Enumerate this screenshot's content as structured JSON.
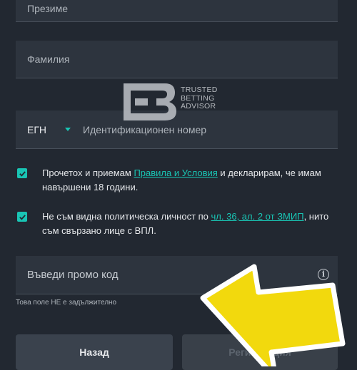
{
  "form": {
    "middle_name_placeholder": "Презиме",
    "last_name_placeholder": "Фамилия",
    "id_type_selected": "ЕГН",
    "id_number_placeholder": "Идентификационен номер",
    "promo_placeholder": "Въведи промо код",
    "promo_hint": "Това поле НЕ е задължително"
  },
  "consents": [
    {
      "checked": true,
      "text_before": "Прочетох и приемам ",
      "link": "Правила и Условия",
      "text_after": " и декларирам, че имам навършени 18 години."
    },
    {
      "checked": true,
      "text_before": "Не съм видна политическа личност по ",
      "link": "чл. 36, ал. 2 от ЗМИП",
      "text_after": ", нито съм свързано лице с ВПЛ."
    }
  ],
  "buttons": {
    "back_label": "Назад",
    "register_label": "Регистрация"
  },
  "watermark": {
    "line1": "TRUSTED",
    "line2": "BETTING",
    "line3": "ADVISOR"
  },
  "colors": {
    "background": "#222831",
    "field": "#2d343e",
    "accent": "#19c5b4",
    "arrow": "#f2d90d"
  },
  "icons": {
    "checkbox": "checkmark-icon",
    "dropdown": "chevron-down-icon",
    "info": "info-circle-icon"
  }
}
